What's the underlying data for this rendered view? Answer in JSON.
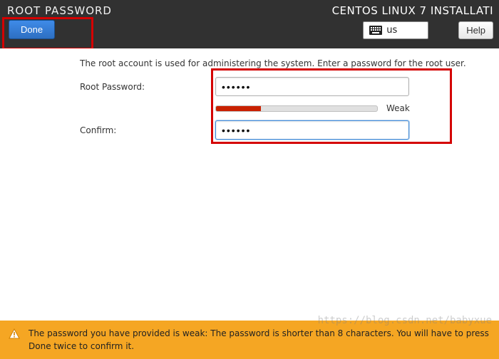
{
  "header": {
    "title": "ROOT PASSWORD",
    "install_title": "CENTOS LINUX 7 INSTALLATI",
    "done_label": "Done",
    "keyboard_layout": "us",
    "help_label": "Help"
  },
  "content": {
    "description": "The root account is used for administering the system.  Enter a password for the root user.",
    "root_password_label": "Root Password:",
    "root_password_value": "••••••",
    "confirm_label": "Confirm:",
    "confirm_value": "••••••",
    "strength_label": "Weak"
  },
  "warning": {
    "text": "The password you have provided is weak: The password is shorter than 8 characters. You will have to press Done twice to confirm it."
  },
  "watermark": "https://blog.csdn.net/babyxue"
}
